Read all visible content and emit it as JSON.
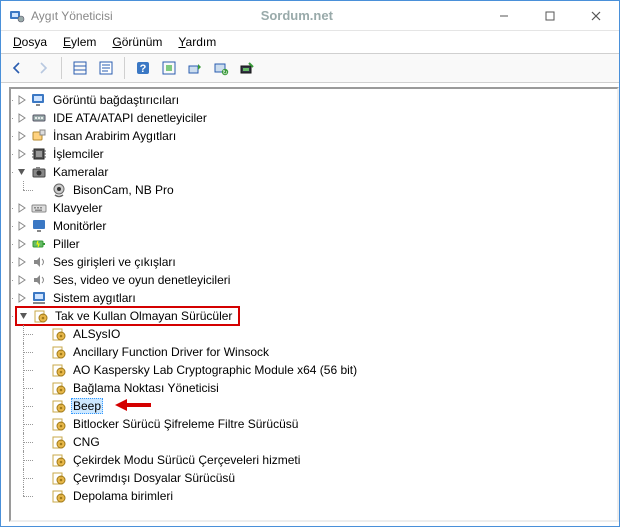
{
  "window": {
    "title": "Aygıt Yöneticisi",
    "watermark": "Sordum.net"
  },
  "menu": {
    "file": "Dosya",
    "action": "Eylem",
    "view": "Görünüm",
    "help": "Yardım"
  },
  "toolbar": {
    "back": "Geri",
    "forward": "İleri",
    "view_list": "Liste Görünümü",
    "properties": "Özellikler",
    "help": "Yardım",
    "refresh": "Yenile",
    "update_driver": "Sürücü Güncelle",
    "uninstall": "Kaldır",
    "scan": "Donanım değişikliği tara"
  },
  "tree": {
    "root": [
      {
        "label": "Görüntü bağdaştırıcıları",
        "icon": "display"
      },
      {
        "label": "IDE ATA/ATAPI denetleyiciler",
        "icon": "ide"
      },
      {
        "label": "İnsan Arabirim Aygıtları",
        "icon": "hid"
      },
      {
        "label": "İşlemciler",
        "icon": "cpu"
      },
      {
        "label": "Kameralar",
        "icon": "camera",
        "expanded": true,
        "children": [
          {
            "label": "BisonCam, NB Pro",
            "icon": "webcam"
          }
        ]
      },
      {
        "label": "Klavyeler",
        "icon": "keyboard"
      },
      {
        "label": "Monitörler",
        "icon": "monitor"
      },
      {
        "label": "Piller",
        "icon": "battery"
      },
      {
        "label": "Ses girişleri ve çıkışları",
        "icon": "audio"
      },
      {
        "label": "Ses, video ve oyun denetleyicileri",
        "icon": "audio"
      },
      {
        "label": "Sistem aygıtları",
        "icon": "system",
        "expanded": true
      },
      {
        "label": "Tak ve Kullan Olmayan Sürücüler",
        "icon": "npnp",
        "expanded": true,
        "highlight": true,
        "children": [
          {
            "label": "ALSysIO",
            "icon": "npnp"
          },
          {
            "label": "Ancillary Function Driver for Winsock",
            "icon": "npnp"
          },
          {
            "label": "AO Kaspersky Lab Cryptographic Module x64 (56 bit)",
            "icon": "npnp"
          },
          {
            "label": "Bağlama Noktası Yöneticisi",
            "icon": "npnp"
          },
          {
            "label": "Beep",
            "icon": "npnp",
            "selected": true,
            "arrow": true
          },
          {
            "label": "Bitlocker Sürücü Şifreleme Filtre Sürücüsü",
            "icon": "npnp"
          },
          {
            "label": "CNG",
            "icon": "npnp"
          },
          {
            "label": "Çekirdek Modu Sürücü Çerçeveleri hizmeti",
            "icon": "npnp"
          },
          {
            "label": "Çevrimdışı Dosyalar Sürücüsü",
            "icon": "npnp"
          },
          {
            "label": "Depolama birimleri",
            "icon": "npnp"
          }
        ]
      }
    ]
  }
}
